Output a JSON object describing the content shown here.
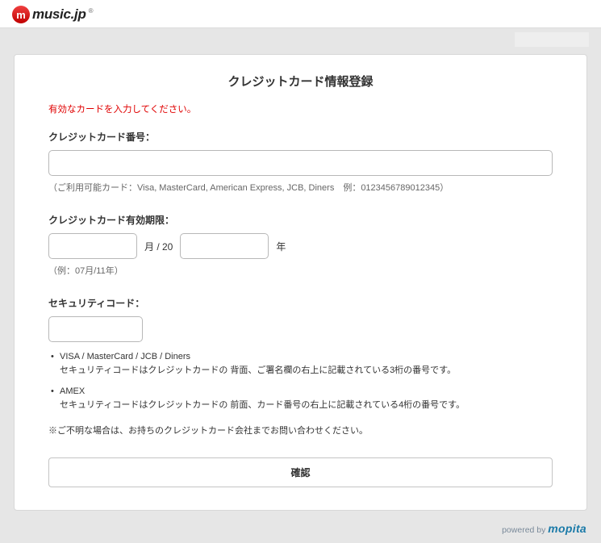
{
  "header": {
    "logo_letter": "m",
    "logo_text": "music.jp",
    "logo_r": "®"
  },
  "form": {
    "title": "クレジットカード情報登録",
    "error": "有効なカードを入力してください。",
    "card_number": {
      "label": "クレジットカード番号：",
      "value": "",
      "hint": "（ご利用可能カード：Visa, MasterCard, American Express, JCB, Diners　例：0123456789012345）"
    },
    "expiry": {
      "label": "クレジットカード有効期限：",
      "month_value": "",
      "sep1": "月 / 20",
      "year_value": "",
      "sep2": "年",
      "hint": "（例：07月/11年）"
    },
    "cvv": {
      "label": "セキュリティコード：",
      "value": "",
      "bullets": [
        {
          "title": "VISA / MasterCard / JCB / Diners",
          "desc": "セキュリティコードはクレジットカードの 背面、ご署名欄の右上に記載されている3桁の番号です。"
        },
        {
          "title": "AMEX",
          "desc": "セキュリティコードはクレジットカードの 前面、カード番号の右上に記載されている4桁の番号です。"
        }
      ],
      "note": "※ご不明な場合は、お持ちのクレジットカード会社までお問い合わせください。"
    },
    "submit": "確認"
  },
  "footer": {
    "powered_by": "powered by ",
    "brand": "mopita"
  }
}
